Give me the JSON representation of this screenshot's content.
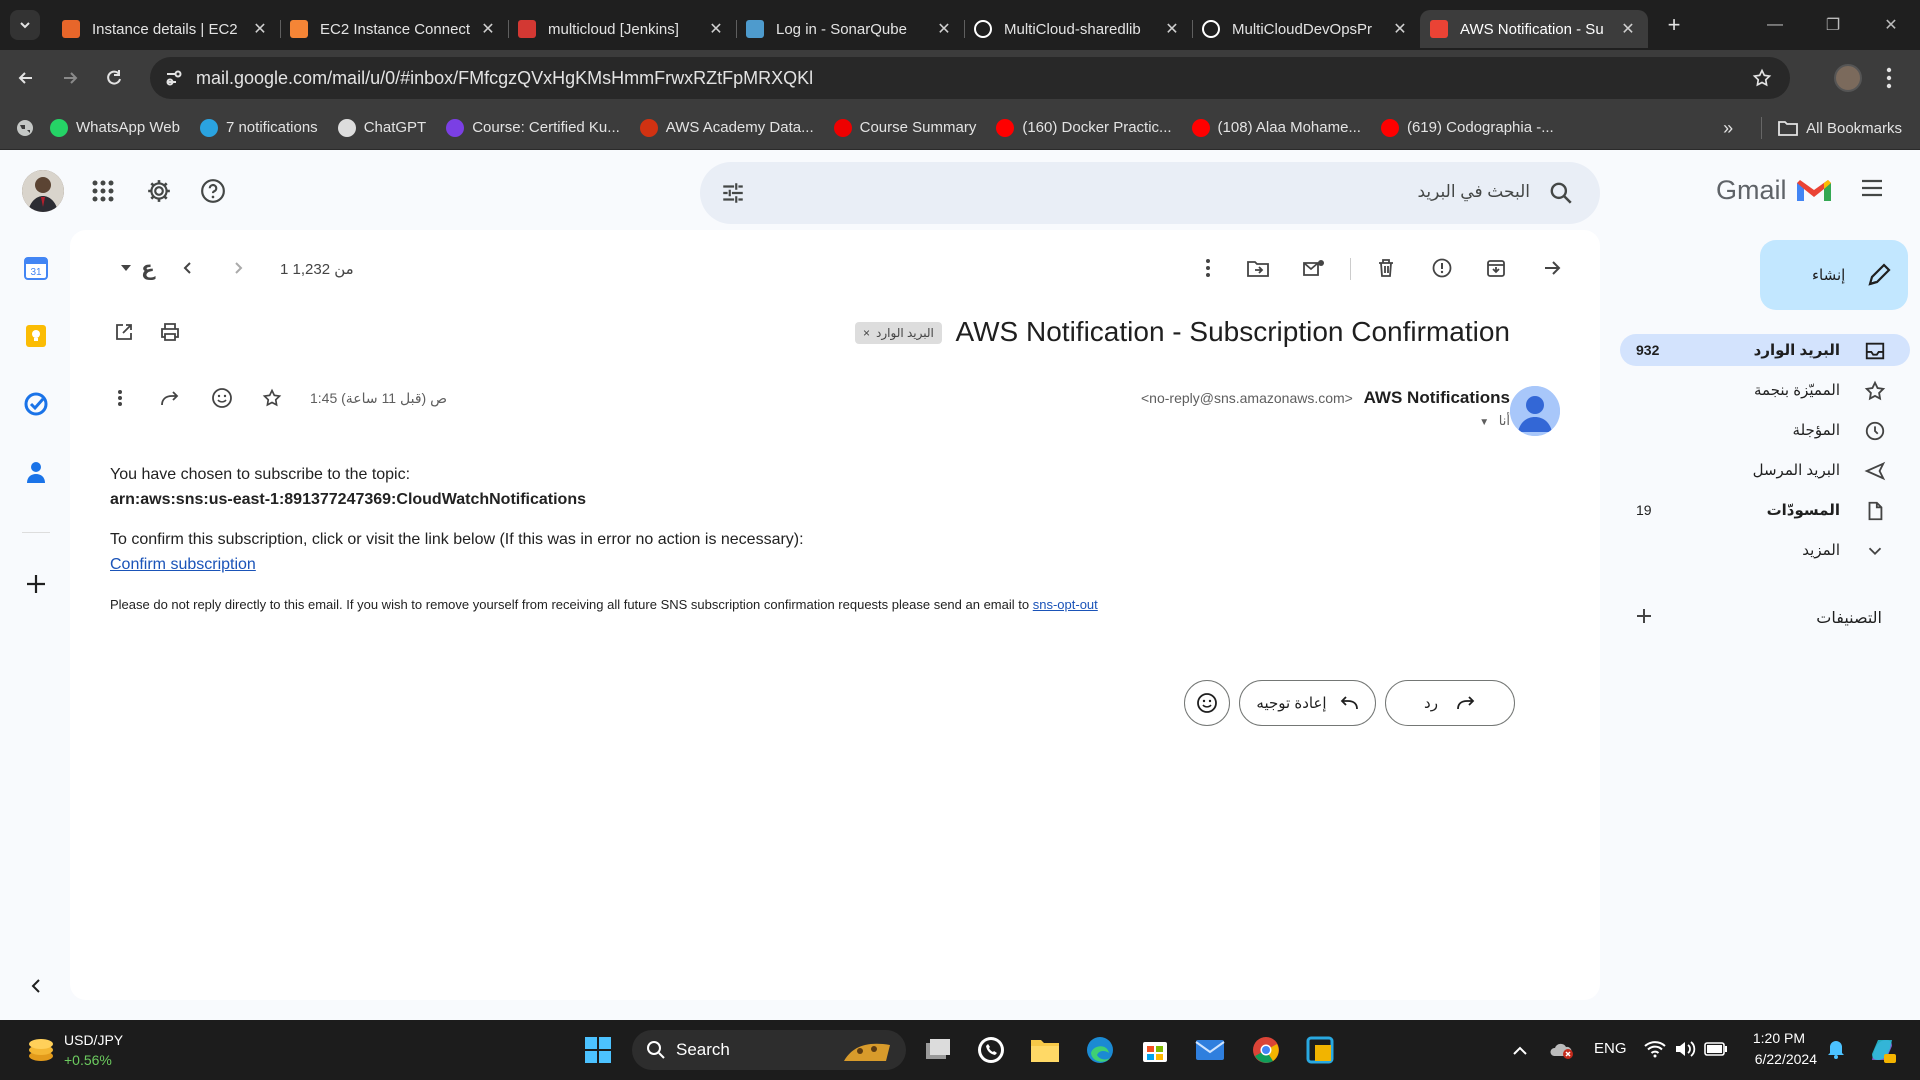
{
  "browser": {
    "tabs": [
      {
        "title": "Instance details | EC2",
        "icon": "aws-ec2-icon",
        "color": "#e7662a"
      },
      {
        "title": "EC2 Instance Connect",
        "icon": "aws-box-icon",
        "color": "#f58536"
      },
      {
        "title": "multicloud [Jenkins]",
        "icon": "jenkins-icon",
        "color": "#d33833"
      },
      {
        "title": "Log in - SonarQube",
        "icon": "sonarqube-icon",
        "color": "#4e9bcd"
      },
      {
        "title": "MultiCloud-sharedlib",
        "icon": "github-icon",
        "color": "#ffffff"
      },
      {
        "title": "MultiCloudDevOpsPr",
        "icon": "github-icon",
        "color": "#ffffff"
      },
      {
        "title": "AWS Notification - Su",
        "icon": "gmail-icon",
        "color": "#ea4335"
      }
    ],
    "url": "mail.google.com/mail/u/0/#inbox/FMfcgzQVxHgKMsHmmFrwxRZtFpMRXQKl",
    "bookmarks": [
      {
        "label": "WhatsApp Web",
        "color": "#25d366"
      },
      {
        "label": "7 notifications",
        "color": "#2aa3e0"
      },
      {
        "label": "ChatGPT",
        "color": "#dddddd"
      },
      {
        "label": "Course: Certified Ku...",
        "color": "#7b3fe4"
      },
      {
        "label": "AWS Academy Data...",
        "color": "#d13212"
      },
      {
        "label": "Course Summary",
        "color": "#e00"
      },
      {
        "label": "(160) Docker Practic...",
        "color": "#ff0000"
      },
      {
        "label": "(108) Alaa Mohame...",
        "color": "#ff0000"
      },
      {
        "label": "(619) Codographia -...",
        "color": "#ff0000"
      }
    ],
    "all_bookmarks": "All Bookmarks"
  },
  "gmail": {
    "search_placeholder": "البحث في البريد",
    "logo_text": "Gmail",
    "pager": "1 من 1,232",
    "subject": "AWS Notification - Subscription Confirmation",
    "label_chip": "البريد الوارد",
    "sender_name": "AWS Notifications",
    "sender_addr": "<no-reply@sns.amazonaws.com>",
    "to_me": "أنا",
    "time": "1:45 ص (قبل 11 ساعة)",
    "body_line1": "You have chosen to subscribe to the topic:",
    "body_arn": "arn:aws:sns:us-east-1:891377247369:CloudWatchNotifications",
    "body_line2": "To confirm this subscription, click or visit the link below (If this was in error no action is necessary):",
    "confirm_link": "Confirm subscription",
    "body_small": "Please do not reply directly to this email. If you wish to remove yourself from receiving all future SNS subscription confirmation requests please send an email to",
    "optout_link": "sns-opt-out",
    "reply_label": "رد",
    "forward_label": "إعادة توجيه",
    "compose_label": "إنشاء",
    "nav": [
      {
        "label": "البريد الوارد",
        "count": "932",
        "icon": "inbox-icon"
      },
      {
        "label": "المميّزة بنجمة",
        "count": "",
        "icon": "star-icon"
      },
      {
        "label": "المؤجلة",
        "count": "",
        "icon": "clock-icon"
      },
      {
        "label": "البريد المرسل",
        "count": "",
        "icon": "send-icon"
      },
      {
        "label": "المسودّات",
        "count": "19",
        "icon": "draft-icon"
      },
      {
        "label": "المزيد",
        "count": "",
        "icon": "chevron-down-icon"
      }
    ],
    "labels_heading": "التصنيفات"
  },
  "taskbar": {
    "ticker": "USD/JPY",
    "ticker_change": "+0.56%",
    "search_label": "Search",
    "lang": "ENG",
    "time": "1:20 PM",
    "date": "6/22/2024"
  }
}
